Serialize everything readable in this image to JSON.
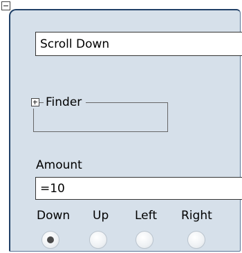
{
  "step": {
    "name_value": "Scroll Down",
    "finder_label": "Finder",
    "amount_label": "Amount",
    "amount_value": "=10",
    "directions": [
      {
        "label": "Down",
        "selected": true
      },
      {
        "label": "Up",
        "selected": false
      },
      {
        "label": "Left",
        "selected": false
      },
      {
        "label": "Right",
        "selected": false
      }
    ]
  },
  "icons": {
    "collapse": "minus-box-icon",
    "expand": "plus-box-icon"
  },
  "colors": {
    "panel_background": "#d6e0ea",
    "panel_border": "#1f3f66"
  }
}
